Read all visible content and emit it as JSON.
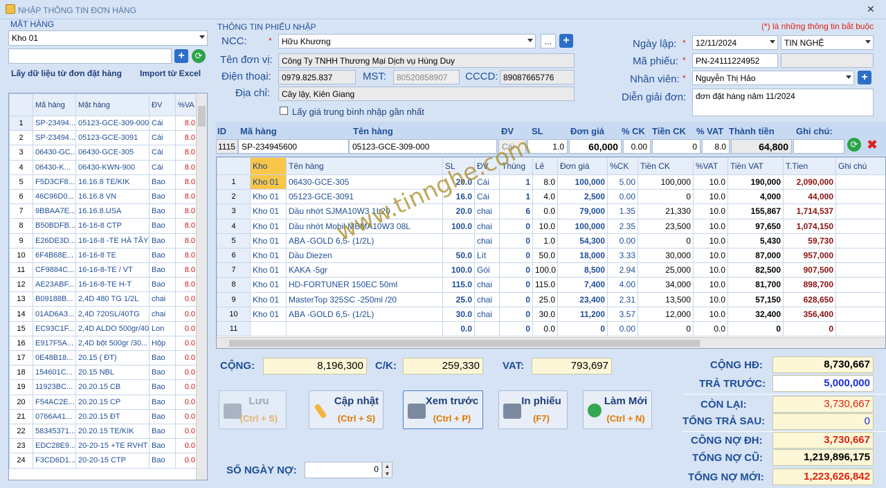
{
  "window": {
    "title": "NHẬP THÔNG TIN ĐƠN HÀNG"
  },
  "left": {
    "section_label": "MẶT HÀNG",
    "warehouse": "Kho 01",
    "search_value": "",
    "link_order": "Lấy dữ liệu từ đơn đặt hàng",
    "link_excel": "Import từ Excel",
    "columns": [
      "Mã hàng",
      "Mặt hàng",
      "ĐV",
      "%VA"
    ],
    "rows": [
      [
        "1",
        "SP-23494...",
        "05123-GCE-309-000",
        "Cái",
        "8.0"
      ],
      [
        "2",
        "SP-23494...",
        "05123-GCE-3091",
        "Cái",
        "8.0"
      ],
      [
        "3",
        "06430-GC...",
        "06430-GCE-305",
        "Cái",
        "8.0"
      ],
      [
        "4",
        "06430-K...",
        "06430-KWN-900",
        "Cái",
        "8.0"
      ],
      [
        "5",
        "F5D3CF8...",
        "16.16.8 TE/KIK",
        "Bao",
        "8.0"
      ],
      [
        "6",
        "46C96D0...",
        "16.16.8 VN",
        "Bao",
        "8.0"
      ],
      [
        "7",
        "9BBAA7E...",
        "16.16.8.USA",
        "Bao",
        "8.0"
      ],
      [
        "8",
        "B50BDFB...",
        "16-16-8  CTP",
        "Bao",
        "8.0"
      ],
      [
        "9",
        "E26DE3D...",
        "16-16-8 -TE HÀ TÂY",
        "Bao",
        "8.0"
      ],
      [
        "10",
        "6F4B68E...",
        "16-16-8 TE",
        "Bao",
        "8.0"
      ],
      [
        "11",
        "CF9884C...",
        "16-16-8-TE / VT",
        "Bao",
        "8.0"
      ],
      [
        "12",
        "AE23ABF...",
        "16-16-8-TE H-T",
        "Bao",
        "8.0"
      ],
      [
        "13",
        "B09188B...",
        "2,4D  480 TG 1/2L",
        "chai",
        "0.0"
      ],
      [
        "14",
        "01AD6A3...",
        "2,4D 720SL/40TG",
        "chai",
        "0.0"
      ],
      [
        "15",
        "EC93C1F...",
        "2,4D ALDO 500gr/40",
        "Lon",
        "0.0"
      ],
      [
        "16",
        "E917F5A...",
        "2,4D bột 500gr /30...",
        "Hộp",
        "0.0"
      ],
      [
        "17",
        "0E48B18...",
        "20.15 ( ĐT)",
        "Bao",
        "0.0"
      ],
      [
        "18",
        "154601C...",
        "20.15 NBL",
        "Bao",
        "0.0"
      ],
      [
        "19",
        "11923BC...",
        "20.20.15 CB",
        "Bao",
        "0.0"
      ],
      [
        "20",
        "F54AC2E...",
        "20.20.15 CP",
        "Bao",
        "0.0"
      ],
      [
        "21",
        "0766A41...",
        "20.20.15 ĐT",
        "Bao",
        "0.0"
      ],
      [
        "22",
        "58345371...",
        "20.20.15 TE/KIK",
        "Bao",
        "0.0"
      ],
      [
        "23",
        "EDC28E9...",
        "20-20-15 +TE RVHT",
        "Bao",
        "0.0"
      ],
      [
        "24",
        "F3CD6D1...",
        "20-20-15 CTP",
        "Bao",
        "0.0"
      ]
    ]
  },
  "receipt": {
    "section_label": "THÔNG TIN PHIẾU NHẬP",
    "required_note": "(*) là những thông tin bắt buộc",
    "ncc_label": "NCC:",
    "ncc_value": "Hữu Khương",
    "more_btn": "...",
    "unit_label": "Tên đơn vị:",
    "unit_value": "Công Ty TNHH Thương Mại Dịch vụ Hùng Duy",
    "phone_label": "Điện thoại:",
    "phone_value": "0979.825.837",
    "mst_label": "MST:",
    "mst_value": "80520858907",
    "cccd_label": "CCCD:",
    "cccd_value": "89087665776",
    "addr_label": "Địa chỉ:",
    "addr_value": "Cây lậy, Kiên Giang",
    "avg_price_label": "Lấy giá trung bình nhập gần nhất",
    "date_label": "Ngày lập:",
    "date_value": "12/11/2024",
    "company_value": "TIN NGHỆ",
    "code_label": "Mã phiếu:",
    "code_value": "PN-24111224952",
    "staff_label": "Nhân viên:",
    "staff_value": "Nguyễn Thị Hảo",
    "note_label": "Diễn giải đơn:",
    "note_value": "đơn đặt hàng năm 11/2024",
    "star": "*"
  },
  "entry": {
    "headers": {
      "id": "ID",
      "code": "Mã hàng",
      "name": "Tên hàng",
      "unit": "ĐV",
      "qty": "SL",
      "price": "Đơn giá",
      "pck": "% CK",
      "ck": "Tiền CK",
      "vat": "% VAT",
      "total": "Thành tiền",
      "note": "Ghi chú:"
    },
    "values": {
      "id": "1115",
      "code": "SP-234945600",
      "name": "05123-GCE-309-000",
      "unit": "Cái",
      "qty": "1.0",
      "price": "60,000",
      "pck": "0.00",
      "ck": "0",
      "vat": "8.0",
      "total": "64,800",
      "note": ""
    }
  },
  "grid": {
    "columns": [
      "Kho",
      "Tên hàng",
      "SL",
      "ĐV",
      "Thùng",
      "Lẻ",
      "Đơn giá",
      "%CK",
      "Tiền CK",
      "%VAT",
      "Tiền VAT",
      "T.Tien",
      "Ghi chú"
    ],
    "rows": [
      [
        "1",
        "Kho 01",
        "06430-GCE-305",
        "20.0",
        "Cái",
        "1",
        "8.0",
        "100,000",
        "5.00",
        "100,000",
        "10.0",
        "190,000",
        "2,090,000",
        ""
      ],
      [
        "2",
        "Kho 01",
        "05123-GCE-3091",
        "16.0",
        "Cái",
        "1",
        "4.0",
        "2,500",
        "0.00",
        "0",
        "10.0",
        "4,000",
        "44,000",
        ""
      ],
      [
        "3",
        "Kho 01",
        "Dầu nhớt SJMA10W3 1L20",
        "20.0",
        "chai",
        "6",
        "0.0",
        "79,000",
        "1.35",
        "21,330",
        "10.0",
        "155,867",
        "1,714,537",
        ""
      ],
      [
        "4",
        "Kho 01",
        "Dầu nhớt Mobil MBMA10W3 08L",
        "100.0",
        "chai",
        "0",
        "10.0",
        "100,000",
        "2.35",
        "23,500",
        "10.0",
        "97,650",
        "1,074,150",
        ""
      ],
      [
        "5",
        "Kho 01",
        "ABA -GOLD 6,5- (1/2L)",
        "",
        "chai",
        "0",
        "1.0",
        "54,300",
        "0.00",
        "0",
        "10.0",
        "5,430",
        "59,730",
        ""
      ],
      [
        "6",
        "Kho 01",
        "Dầu Diezen",
        "50.0",
        "Lít",
        "0",
        "50.0",
        "18,000",
        "3.33",
        "30,000",
        "10.0",
        "87,000",
        "957,000",
        ""
      ],
      [
        "7",
        "Kho 01",
        "KAKA -5gr",
        "100.0",
        "Gói",
        "0",
        "100.0",
        "8,500",
        "2.94",
        "25,000",
        "10.0",
        "82,500",
        "907,500",
        ""
      ],
      [
        "8",
        "Kho 01",
        "HD-FORTUNER 150EC 50ml",
        "115.0",
        "chai",
        "0",
        "115.0",
        "7,400",
        "4.00",
        "34,000",
        "10.0",
        "81,700",
        "898,700",
        ""
      ],
      [
        "9",
        "Kho 01",
        "MasterTop 325SC -250ml /20",
        "25.0",
        "chai",
        "0",
        "25.0",
        "23,400",
        "2.31",
        "13,500",
        "10.0",
        "57,150",
        "628,650",
        ""
      ],
      [
        "10",
        "Kho 01",
        "ABA -GOLD 6,5- (1/2L)",
        "30.0",
        "chai",
        "0",
        "30.0",
        "11,200",
        "3.57",
        "12,000",
        "10.0",
        "32,400",
        "356,400",
        ""
      ],
      [
        "11",
        "",
        "",
        "0.0",
        "",
        "0",
        "0.0",
        "0",
        "0.00",
        "0",
        "0.0",
        "0",
        "0",
        ""
      ]
    ]
  },
  "totals": {
    "cong_label": "CỘNG:",
    "cong_value": "8,196,300",
    "ck_label": "C/K:",
    "ck_value": "259,330",
    "vat_label": "VAT:",
    "vat_value": "793,697",
    "songay_label": "SỐ NGÀY NỢ:",
    "songay_value": "0"
  },
  "buttons": {
    "save": [
      "Lưu",
      "(Ctrl + S)"
    ],
    "update": [
      "Cập nhật",
      "(Ctrl + S)"
    ],
    "preview": [
      "Xem trước",
      "(Ctrl + P)"
    ],
    "print": [
      "In phiếu",
      "(F7)"
    ],
    "new": [
      "Làm Mới",
      "(Ctrl + N)"
    ]
  },
  "summary": {
    "cong_hd_label": "CỘNG HĐ:",
    "cong_hd": "8,730,667",
    "tra_truoc_label": "TRẢ TRƯỚC:",
    "tra_truoc": "5,000,000",
    "con_lai_label": "CÒN LẠI:",
    "con_lai": "3,730,667",
    "tong_tra_sau_label": "TỔNG TRẢ SAU:",
    "tong_tra_sau": "0",
    "cong_no_dh_label": "CÔNG NỢ ĐH:",
    "cong_no_dh": "3,730,667",
    "tong_no_cu_label": "TỔNG NỢ CŨ:",
    "tong_no_cu": "1,219,896,175",
    "tong_no_moi_label": "TỔNG NỢ MỚI:",
    "tong_no_moi": "1,223,626,842"
  },
  "watermark": "www.tinnghe.com"
}
